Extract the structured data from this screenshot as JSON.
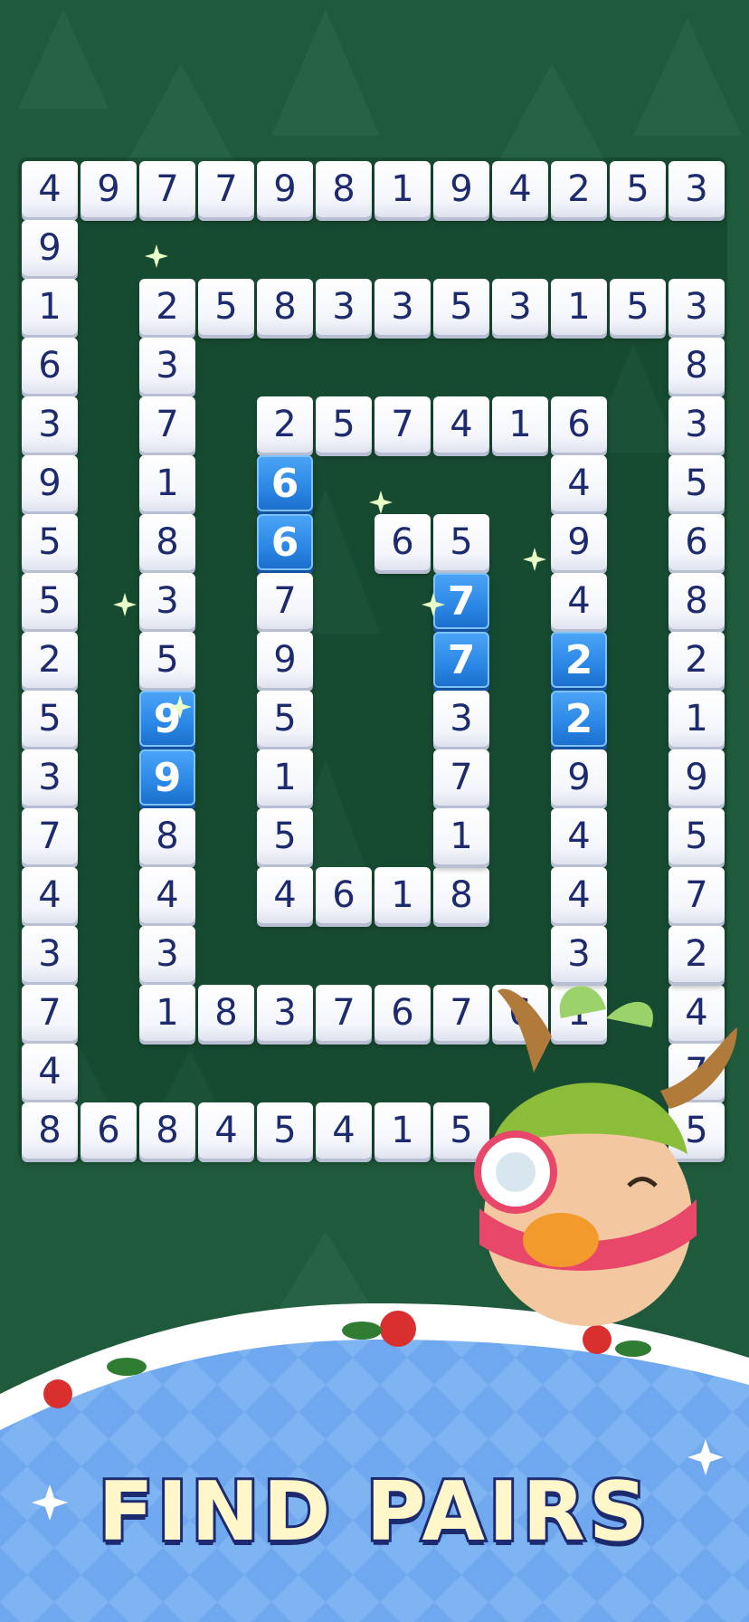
{
  "grid": {
    "outer_top": [
      "4",
      "9",
      "7",
      "7",
      "9",
      "8",
      "1",
      "9",
      "4",
      "2",
      "5",
      "3"
    ],
    "outer_left": [
      "9",
      "1",
      "6",
      "3",
      "9",
      "5",
      "5",
      "2",
      "5",
      "3",
      "7",
      "4",
      "3",
      "7",
      "4"
    ],
    "outer_bottom": [
      "8",
      "6",
      "8",
      "4",
      "5",
      "4",
      "1",
      "5"
    ],
    "outer_right_visible": [
      "4",
      "7",
      "5"
    ],
    "ring2_top": [
      "2",
      "5",
      "8",
      "3",
      "3",
      "5",
      "3",
      "1",
      "5",
      "3"
    ],
    "ring2_right": [
      "8",
      "3",
      "5",
      "6",
      "8",
      "2",
      "1",
      "9",
      "5",
      "7",
      "2"
    ],
    "ring2_left": [
      "3",
      "7",
      "1",
      "8",
      "3",
      "5",
      "9",
      "9",
      "8",
      "4",
      "3"
    ],
    "ring2_bottom": [
      "1",
      "8",
      "3",
      "7",
      "6",
      "7",
      "6",
      "1"
    ],
    "ring3_top": [
      "2",
      "5",
      "7",
      "4",
      "1",
      "6"
    ],
    "ring3_left": [
      "6",
      "6",
      "7",
      "9",
      "5",
      "1",
      "5"
    ],
    "ring3_bottom": [
      "4",
      "6",
      "1",
      "8"
    ],
    "ring3_right": [
      "4",
      "9",
      "4",
      "2",
      "2",
      "9",
      "4",
      "4",
      "3"
    ],
    "inner_top": [
      "6",
      "5"
    ],
    "inner_column": [
      "7",
      "7",
      "3",
      "7",
      "1"
    ],
    "selected_pairs": [
      {
        "digit": "9",
        "ring": "ring2_left"
      },
      {
        "digit": "6",
        "ring": "ring3_left"
      },
      {
        "digit": "7",
        "ring": "inner_column"
      },
      {
        "digit": "2",
        "ring": "ring3_right"
      }
    ]
  },
  "banner": {
    "title": "FIND PAIRS"
  },
  "colors": {
    "background": "#1f5a3d",
    "tile": "#ffffff",
    "tile_text": "#1d2a6e",
    "selected_tile": "#2b87e6",
    "title_fill": "#fff6c9",
    "title_stroke": "#1d2a6e",
    "snow": "#ffffff",
    "ice": "#6fa8ee"
  },
  "icons": [
    "pine-tree-icon",
    "sparkle-icon",
    "poinsettia-icon",
    "snowflake-icon",
    "reindeer-mascot"
  ]
}
